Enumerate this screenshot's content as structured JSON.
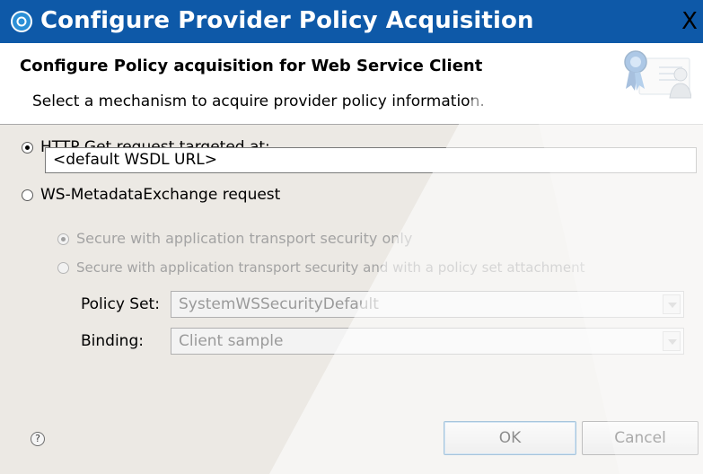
{
  "window": {
    "title": "Configure Provider Policy Acquisition",
    "close_label": "X"
  },
  "banner": {
    "title": "Configure Policy acquisition for Web Service Client",
    "description": "Select a mechanism to acquire provider policy information.",
    "icon": "certificate-user-icon"
  },
  "options": {
    "http_get": {
      "label": "HTTP Get request targeted at:",
      "selected": true
    },
    "url_value": "<default WSDL URL>",
    "ws_metadata": {
      "label": "WS-MetadataExchange request",
      "selected": false
    },
    "secure_transport_only": {
      "label": "Secure with application transport security only",
      "selected": true,
      "enabled": false
    },
    "secure_with_policy": {
      "label": "Secure with application transport security and with a policy set attachment",
      "selected": false,
      "enabled": false
    }
  },
  "policy_set": {
    "label": "Policy Set:",
    "value": "SystemWSSecurityDefault"
  },
  "binding": {
    "label": "Binding:",
    "value": "Client sample"
  },
  "footer": {
    "help_icon": "help-icon",
    "ok_label": "OK",
    "cancel_label": "Cancel"
  },
  "colors": {
    "titlebar": "#0e59a8",
    "dialog_bg": "#ece9e4",
    "disabled_text": "#a3a3a3"
  }
}
